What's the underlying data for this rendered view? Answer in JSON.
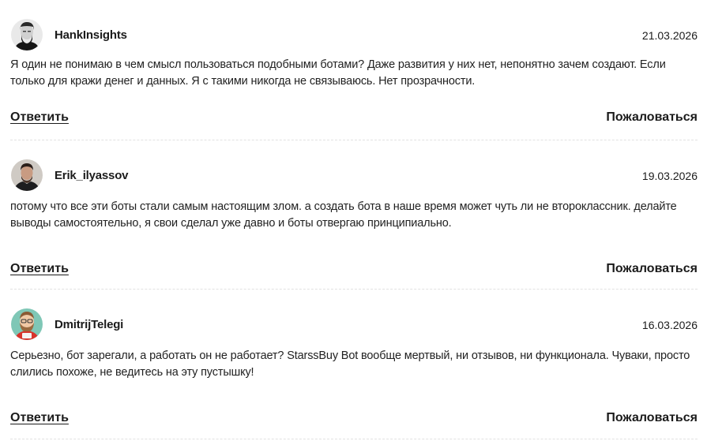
{
  "comments": [
    {
      "author": "HankInsights",
      "date": "21.03.2026",
      "text": "Я один не понимаю в чем смысл пользоваться подобными ботами? Даже развития у них нет, непонятно зачем создают. Если только для кражи денег и данных. Я с такими никогда не связываюсь. Нет прозрачности.",
      "reply_label": "Ответить",
      "report_label": "Пожаловаться",
      "avatar": "avatar-bw-portrait"
    },
    {
      "author": "Erik_ilyassov",
      "date": "19.03.2026",
      "text": "потому что все эти боты стали самым настоящим злом. а создать бота в наше время может чуть ли не второклассник. делайте выводы самостоятельно, я свои сделал уже давно и боты отвергаю принципиально.",
      "reply_label": "Ответить",
      "report_label": "Пожаловаться",
      "avatar": "avatar-photo-man"
    },
    {
      "author": "DmitrijTelegi",
      "date": "16.03.2026",
      "text": "Серьезно, бот зарегали, а работать он не работает? StarssBuy Bot вообще мертвый, ни отзывов, ни функционала. Чуваки, просто слились похоже, не ведитесь на эту пустышку!",
      "reply_label": "Ответить",
      "report_label": "Пожаловаться",
      "avatar": "avatar-cartoon-bearded"
    }
  ]
}
